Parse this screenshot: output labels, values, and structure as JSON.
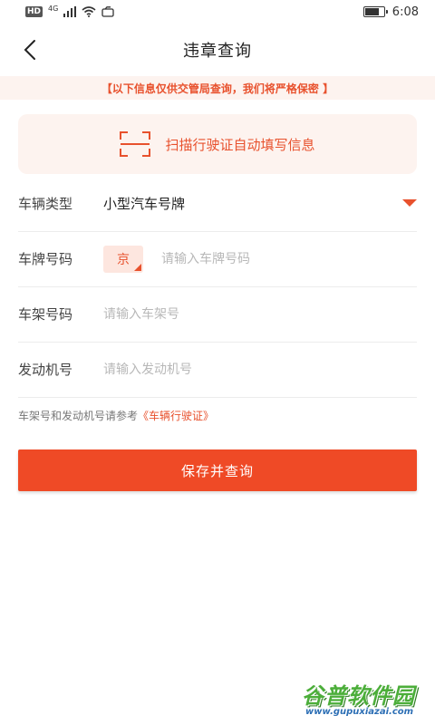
{
  "status_bar": {
    "hd": "HD",
    "network": "4G",
    "time": "6:08",
    "battery_level": 0.75
  },
  "nav": {
    "title": "违章查询"
  },
  "notice": {
    "text": "【以下信息仅供交管局查询，我们将严格保密 】"
  },
  "scan": {
    "label": "扫描行驶证自动填写信息"
  },
  "form": {
    "vehicle_type": {
      "label": "车辆类型",
      "value": "小型汽车号牌"
    },
    "plate": {
      "label": "车牌号码",
      "province": "京",
      "placeholder": "请输入车牌号码"
    },
    "vin": {
      "label": "车架号码",
      "placeholder": "请输入车架号"
    },
    "engine": {
      "label": "发动机号",
      "placeholder": "请输入发动机号"
    }
  },
  "hint": {
    "text": "车架号和发动机号请参考",
    "link": "《车辆行驶证》"
  },
  "submit": {
    "label": "保存并查询"
  },
  "watermark": {
    "main": "谷普软件园",
    "url": "www.gupuxiazai.com"
  },
  "colors": {
    "accent": "#ef4a26",
    "notice_bg": "#fdf3ef"
  }
}
